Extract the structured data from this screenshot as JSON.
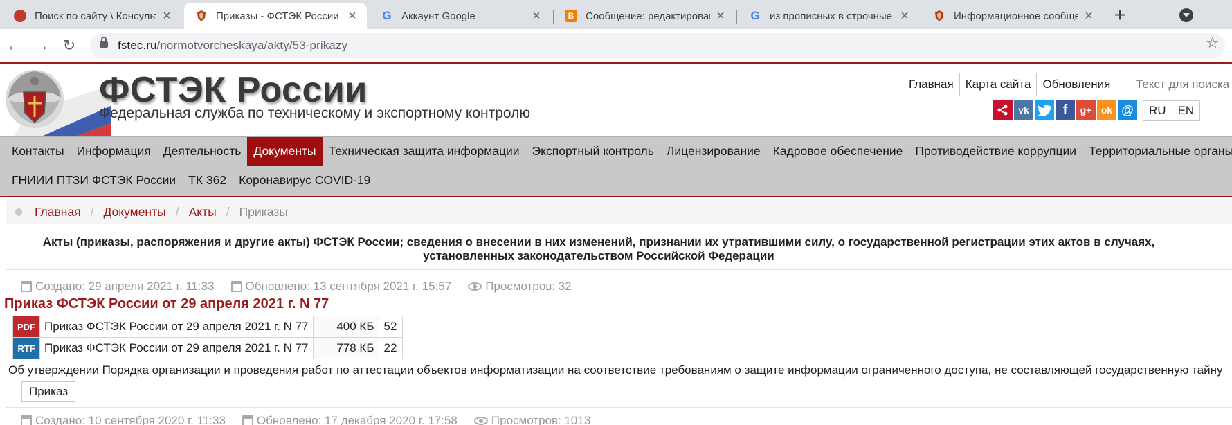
{
  "browser": {
    "tabs": [
      {
        "title": "Поиск по сайту \\ Консульта",
        "favicon": "consultant-favicon",
        "fav_color": "#c0392b",
        "fav_text": ""
      },
      {
        "title": "Приказы - ФСТЭК России",
        "favicon": "fstec-favicon",
        "fav_color": "#b03a2e",
        "fav_text": "",
        "active": true
      },
      {
        "title": "Аккаунт Google",
        "favicon": "google-favicon",
        "fav_color": "#4285f4",
        "fav_text": "G"
      },
      {
        "title": "Сообщение: редактирован",
        "favicon": "blogger-favicon",
        "fav_color": "#f57d00",
        "fav_text": "B"
      },
      {
        "title": "из прописных в строчные",
        "favicon": "google-favicon",
        "fav_color": "#4285f4",
        "fav_text": "G"
      },
      {
        "title": "Информационное сообще",
        "favicon": "fstec-favicon",
        "fav_color": "#b03a2e",
        "fav_text": ""
      }
    ],
    "url_host": "fstec.ru",
    "url_path": "/normotvorcheskaya/akty/53-prikazy"
  },
  "header": {
    "title": "ФСТЭК России",
    "subtitle": "Федеральная служба по техническому и экспортному контролю",
    "top_links": [
      "Главная",
      "Карта сайта",
      "Обновления"
    ],
    "search_placeholder": "Текст для поиска",
    "social": [
      {
        "name": "share-icon",
        "color": "#c8102e",
        "glyph": "<"
      },
      {
        "name": "vk-icon",
        "color": "#4a76a8",
        "glyph": "vk"
      },
      {
        "name": "twitter-icon",
        "color": "#1da1f2",
        "glyph": "t"
      },
      {
        "name": "facebook-icon",
        "color": "#3b5998",
        "glyph": "f"
      },
      {
        "name": "googleplus-icon",
        "color": "#dd4b39",
        "glyph": "g+"
      },
      {
        "name": "odnoklassniki-icon",
        "color": "#f7931e",
        "glyph": "ok"
      },
      {
        "name": "mail-icon",
        "color": "#168de2",
        "glyph": "@"
      }
    ],
    "langs": [
      "RU",
      "EN"
    ]
  },
  "nav": {
    "row1": [
      "Контакты",
      "Информация",
      "Деятельность",
      "Документы",
      "Техническая защита информации",
      "Экспортный контроль",
      "Лицензирование",
      "Кадровое обеспечение",
      "Противодействие коррупции",
      "Территориальные органы"
    ],
    "row2": [
      "ГНИИИ ПТЗИ ФСТЭК России",
      "ТК 362",
      "Коронавирус COVID-19"
    ],
    "active": "Документы"
  },
  "breadcrumb": [
    "Главная",
    "Документы",
    "Акты",
    "Приказы"
  ],
  "category_title": "Акты (приказы, распоряжения и другие акты) ФСТЭК России; сведения о внесении в них изменений, признании их утратившими силу, о государственной регистрации этих актов в случаях, установленных законодательством Российской Федерации",
  "articles": [
    {
      "created": "Создано: 29 апреля 2021 г. 11:33",
      "updated": "Обновлено: 13 сентября 2021 г. 15:57",
      "views": "Просмотров: 32",
      "title": "Приказ ФСТЭК России от 29 апреля 2021 г. N 77",
      "files": [
        {
          "type": "PDF",
          "color": "#c0272d",
          "name": "Приказ ФСТЭК России от 29 апреля 2021 г. N 77",
          "size": "400 КБ",
          "count": "52"
        },
        {
          "type": "RTF",
          "color": "#1f6fa8",
          "name": "Приказ ФСТЭК России от 29 апреля 2021 г. N 77",
          "size": "778 КБ",
          "count": "22"
        }
      ],
      "description": "Об утверждении Порядка организации и проведения работ по аттестации объектов информатизации на соответствие требованиям о защите информации ограниченного доступа, не составляющей государственную тайну",
      "tag": "Приказ"
    },
    {
      "created": "Создано: 10 сентября 2020 г. 11:33",
      "updated": "Обновлено: 17 декабря 2020 г. 17:58",
      "views": "Просмотров: 1013"
    }
  ]
}
